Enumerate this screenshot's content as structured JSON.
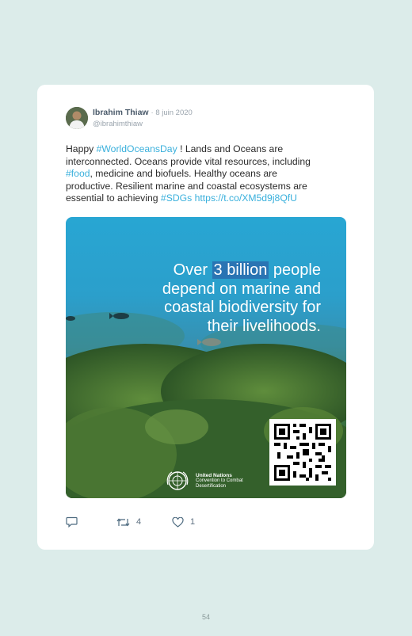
{
  "tweet": {
    "author_name": "Ibrahim Thiaw",
    "date": "· 8 juin 2020",
    "handle": "@ibrahimthiaw",
    "text_parts": {
      "p1": "Happy ",
      "tag1": "#WorldOceansDay",
      "p2": " ! Lands and Oceans are interconnected. Oceans provide vital resources, including ",
      "tag2": "#food",
      "p3": ", medicine and biofuels. Healthy oceans are productive. Resilient marine and coastal ecosystems are essential to achieving ",
      "tag3": "#SDGs",
      "p4": " ",
      "link": "https://t.co/XM5d9j8QfU"
    }
  },
  "media": {
    "line1_pre": "Over ",
    "line1_boxed": "3 billion",
    "line1_post": " people",
    "line2": "depend on marine and",
    "line3": "coastal biodiversity for",
    "line4": "their livelihoods.",
    "org_line1": "United Nations",
    "org_line2": "Convention to Combat",
    "org_line3": "Desertification"
  },
  "actions": {
    "reply_icon": "reply-icon",
    "retweet_icon": "retweet-icon",
    "retweet_count": "4",
    "like_icon": "heart-icon",
    "like_count": "1"
  },
  "page_number": "54",
  "colors": {
    "background": "#dcecea",
    "link": "#3ab0dc",
    "highlight_box": "#2a74b3"
  }
}
